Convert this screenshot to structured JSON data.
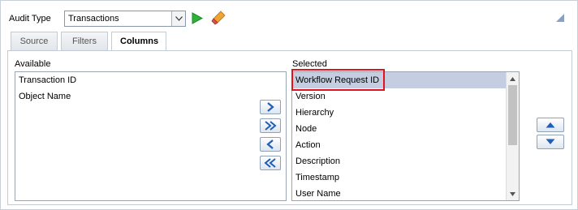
{
  "toolbar": {
    "audit_type_label": "Audit Type",
    "audit_type_value": "Transactions",
    "icons": [
      "chevron-down-icon",
      "play-icon",
      "eraser-icon",
      "collapse-icon"
    ]
  },
  "tabs": [
    {
      "label": "Source"
    },
    {
      "label": "Filters"
    },
    {
      "label": "Columns",
      "active": true
    }
  ],
  "available": {
    "label": "Available",
    "items": [
      "Transaction ID",
      "Object Name"
    ]
  },
  "selected": {
    "label": "Selected",
    "items": [
      "Workflow Request ID",
      "Version",
      "Hierarchy",
      "Node",
      "Action",
      "Description",
      "Timestamp",
      "User Name"
    ],
    "highlighted_index": 0
  },
  "move_buttons": [
    "move-right-icon",
    "move-all-right-icon",
    "move-left-icon",
    "move-all-left-icon"
  ],
  "order_buttons": [
    "move-up-icon",
    "move-down-icon"
  ],
  "colors": {
    "accent_green": "#2db23a",
    "highlight_red": "#e0131e",
    "selection": "#c5cee0",
    "arrow_blue": "#1f5db8"
  }
}
